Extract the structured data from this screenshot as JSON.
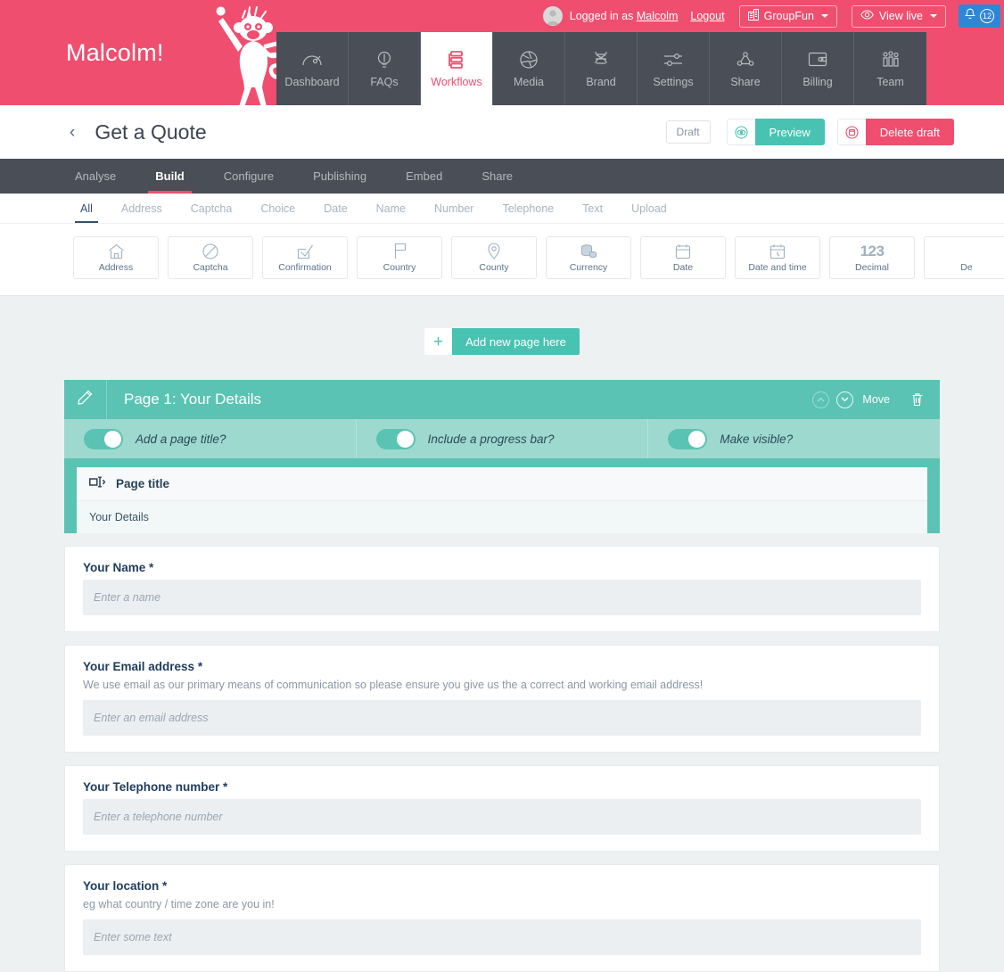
{
  "brand": {
    "name": "Malcolm!",
    "pink": "#ef4e6f",
    "teal": "#49c3b1",
    "dark": "#4a4e57"
  },
  "userbar": {
    "logged_in_prefix": "Logged in as ",
    "username": "Malcolm",
    "logout": "Logout",
    "workspace": "GroupFun",
    "view_live": "View live",
    "notification_count": "12"
  },
  "mainnav": [
    {
      "label": "Dashboard",
      "icon": "gauge-icon",
      "active": false
    },
    {
      "label": "FAQs",
      "icon": "lightbulb-icon",
      "active": false
    },
    {
      "label": "Workflows",
      "icon": "workflow-icon",
      "active": true
    },
    {
      "label": "Media",
      "icon": "aperture-icon",
      "active": false
    },
    {
      "label": "Brand",
      "icon": "dna-icon",
      "active": false
    },
    {
      "label": "Settings",
      "icon": "sliders-icon",
      "active": false
    },
    {
      "label": "Share",
      "icon": "share-icon",
      "active": false
    },
    {
      "label": "Billing",
      "icon": "wallet-icon",
      "active": false
    },
    {
      "label": "Team",
      "icon": "team-icon",
      "active": false
    }
  ],
  "pagehead": {
    "back": "‹",
    "title": "Get a Quote",
    "draft_chip": "Draft",
    "preview_label": "Preview",
    "delete_label": "Delete draft"
  },
  "tabs": [
    {
      "label": "Analyse",
      "active": false
    },
    {
      "label": "Build",
      "active": true
    },
    {
      "label": "Configure",
      "active": false
    },
    {
      "label": "Publishing",
      "active": false
    },
    {
      "label": "Embed",
      "active": false
    },
    {
      "label": "Share",
      "active": false
    }
  ],
  "filters": [
    {
      "label": "All",
      "active": true
    },
    {
      "label": "Address",
      "active": false
    },
    {
      "label": "Captcha",
      "active": false
    },
    {
      "label": "Choice",
      "active": false
    },
    {
      "label": "Date",
      "active": false
    },
    {
      "label": "Name",
      "active": false
    },
    {
      "label": "Number",
      "active": false
    },
    {
      "label": "Telephone",
      "active": false
    },
    {
      "label": "Text",
      "active": false
    },
    {
      "label": "Upload",
      "active": false
    }
  ],
  "field_types": [
    {
      "label": "Address",
      "icon": "house-icon"
    },
    {
      "label": "Captcha",
      "icon": "no-entry-icon"
    },
    {
      "label": "Confirmation",
      "icon": "checkbox-tick-icon"
    },
    {
      "label": "Country",
      "icon": "flag-icon"
    },
    {
      "label": "County",
      "icon": "map-pin-icon"
    },
    {
      "label": "Currency",
      "icon": "coins-icon"
    },
    {
      "label": "Date",
      "icon": "calendar-icon"
    },
    {
      "label": "Date and time",
      "icon": "calendar-clock-icon"
    },
    {
      "label": "Decimal",
      "icon": "123-icon"
    },
    {
      "label": "De",
      "icon": "partial-icon"
    }
  ],
  "add_page_button": {
    "plus": "+",
    "label": "Add new page here"
  },
  "page_card": {
    "title": "Page 1: Your Details",
    "move_label": "Move",
    "toggles": [
      {
        "label": "Add a page title?",
        "on": true
      },
      {
        "label": "Include a progress bar?",
        "on": true
      },
      {
        "label": "Make visible?",
        "on": true
      }
    ],
    "page_title_block": {
      "heading": "Page title",
      "value": "Your Details"
    }
  },
  "fields": [
    {
      "label": "Your Name",
      "required": "*",
      "help": "",
      "placeholder": "Enter a name"
    },
    {
      "label": "Your Email address",
      "required": "*",
      "help": "We use email as our primary means of communication so please ensure you give us the a correct and working email address!",
      "placeholder": "Enter an email address"
    },
    {
      "label": "Your Telephone number",
      "required": "*",
      "help": "",
      "placeholder": "Enter a telephone number"
    },
    {
      "label": "Your location",
      "required": "*",
      "help": "eg what country / time zone are you in!",
      "placeholder": "Enter some text"
    }
  ]
}
